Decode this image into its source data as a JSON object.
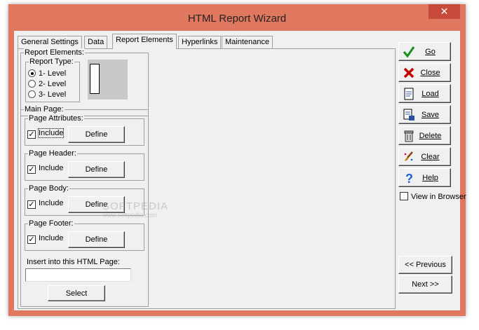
{
  "window": {
    "title": "HTML Report Wizard",
    "close_glyph": "✕"
  },
  "tabs": [
    {
      "label": "General Settings",
      "active": false
    },
    {
      "label": "Data",
      "active": false
    },
    {
      "label": "Report Elements",
      "active": true
    },
    {
      "label": "Hyperlinks",
      "active": false
    },
    {
      "label": "Maintenance",
      "active": false
    }
  ],
  "report_elements": {
    "group_label": "Report Elements:",
    "report_type": {
      "label": "Report Type:",
      "options": [
        "1- Level",
        "2- Level",
        "3- Level"
      ],
      "selected": "1- Level"
    }
  },
  "main_page": {
    "label": "Main Page:",
    "sections": [
      {
        "label": "Page Attributes:",
        "include_label": "Include",
        "checked": true,
        "define_label": "Define"
      },
      {
        "label": "Page Header:",
        "include_label": "Include",
        "checked": true,
        "define_label": "Define"
      },
      {
        "label": "Page Body:",
        "include_label": "Include",
        "checked": true,
        "define_label": "Define"
      },
      {
        "label": "Page Footer:",
        "include_label": "Include",
        "checked": true,
        "define_label": "Define"
      }
    ],
    "insert_label": "Insert into this HTML Page:",
    "insert_value": "",
    "select_label": "Select"
  },
  "sidebar": {
    "buttons": [
      {
        "label": "Go",
        "icon": "checkmark-icon",
        "color": "#1a8f1a"
      },
      {
        "label": "Close",
        "icon": "x-icon",
        "color": "#c00000"
      },
      {
        "label": "Load",
        "icon": "document-icon",
        "color": "#2a4fa0"
      },
      {
        "label": "Save",
        "icon": "save-document-icon",
        "color": "#2a4fa0"
      },
      {
        "label": "Delete",
        "icon": "trash-icon",
        "color": "#444444"
      },
      {
        "label": "Clear",
        "icon": "brush-icon",
        "color": "#c08000"
      },
      {
        "label": "Help",
        "icon": "question-icon",
        "color": "#1f5fd0"
      }
    ],
    "view_in_browser_label": "View in Browser",
    "view_in_browser_checked": false
  },
  "navigation": {
    "previous_label": "<< Previous",
    "next_label": "Next >>"
  },
  "watermark": {
    "brand": "SOFTPEDIA",
    "url": "www.softpedia.com"
  }
}
